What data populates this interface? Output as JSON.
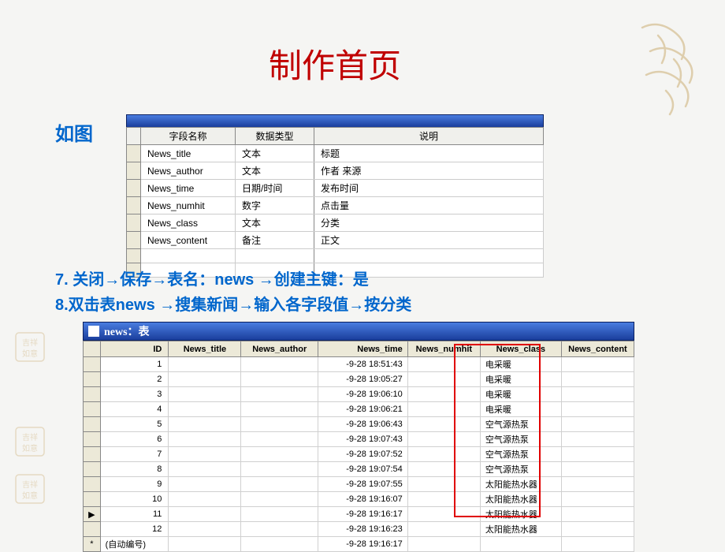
{
  "slide": {
    "title": "制作首页",
    "label": "如图",
    "step7": "7. 关闭→保存→表名：news →创建主键：是",
    "step8": "8.双击表news →搜集新闻→输入各字段值→按分类"
  },
  "table1": {
    "headers": [
      "字段名称",
      "数据类型",
      "说明"
    ],
    "rows": [
      [
        "News_title",
        "文本",
        "标题"
      ],
      [
        "News_author",
        "文本",
        "作者  来源"
      ],
      [
        "News_time",
        "日期/时间",
        "发布时间"
      ],
      [
        "News_numhit",
        "数字",
        "点击量"
      ],
      [
        "News_class",
        "文本",
        "分类"
      ],
      [
        "News_content",
        "备注",
        "正文"
      ]
    ]
  },
  "table2": {
    "title": "news：表",
    "headers": [
      "",
      "ID",
      "News_title",
      "News_author",
      "News_time",
      "News_numhit",
      "News_class",
      "News_content"
    ],
    "rows": [
      {
        "sel": "",
        "id": "1",
        "title": "",
        "author": "",
        "time": "-9-28 18:51:43",
        "numhit": "",
        "class": "电采暖",
        "content": ""
      },
      {
        "sel": "",
        "id": "2",
        "title": "",
        "author": "",
        "time": "-9-28 19:05:27",
        "numhit": "",
        "class": "电采暖",
        "content": ""
      },
      {
        "sel": "",
        "id": "3",
        "title": "",
        "author": "",
        "time": "-9-28 19:06:10",
        "numhit": "",
        "class": "电采暖",
        "content": ""
      },
      {
        "sel": "",
        "id": "4",
        "title": "",
        "author": "",
        "time": "-9-28 19:06:21",
        "numhit": "",
        "class": "电采暖",
        "content": ""
      },
      {
        "sel": "",
        "id": "5",
        "title": "",
        "author": "",
        "time": "-9-28 19:06:43",
        "numhit": "",
        "class": "空气源热泵",
        "content": ""
      },
      {
        "sel": "",
        "id": "6",
        "title": "",
        "author": "",
        "time": "-9-28 19:07:43",
        "numhit": "",
        "class": "空气源热泵",
        "content": ""
      },
      {
        "sel": "",
        "id": "7",
        "title": "",
        "author": "",
        "time": "-9-28 19:07:52",
        "numhit": "",
        "class": "空气源热泵",
        "content": ""
      },
      {
        "sel": "",
        "id": "8",
        "title": "",
        "author": "",
        "time": "-9-28 19:07:54",
        "numhit": "",
        "class": "空气源热泵",
        "content": ""
      },
      {
        "sel": "",
        "id": "9",
        "title": "",
        "author": "",
        "time": "-9-28 19:07:55",
        "numhit": "",
        "class": "太阳能热水器",
        "content": ""
      },
      {
        "sel": "",
        "id": "10",
        "title": "",
        "author": "",
        "time": "-9-28 19:16:07",
        "numhit": "",
        "class": "太阳能热水器",
        "content": ""
      },
      {
        "sel": "▶",
        "id": "11",
        "title": "",
        "author": "",
        "time": "-9-28 19:16:17",
        "numhit": "",
        "class": "太阳能热水器",
        "content": ""
      },
      {
        "sel": "",
        "id": "12",
        "title": "",
        "author": "",
        "time": "-9-28 19:16:23",
        "numhit": "",
        "class": "太阳能热水器",
        "content": ""
      },
      {
        "sel": "*",
        "id": "(自动编号)",
        "title": "",
        "author": "",
        "time": "-9-28 19:16:17",
        "numhit": "",
        "class": "",
        "content": ""
      }
    ]
  }
}
